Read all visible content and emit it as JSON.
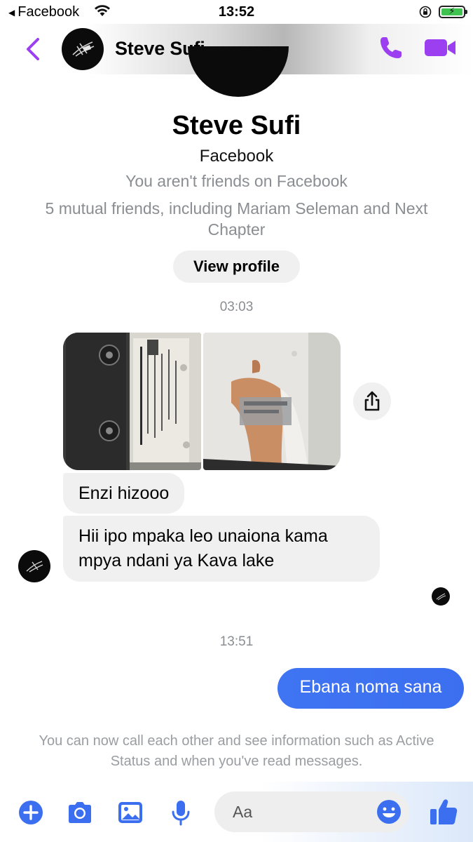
{
  "status_bar": {
    "back_app": "Facebook",
    "time": "13:52"
  },
  "header": {
    "contact_name": "Steve Sufi"
  },
  "profile": {
    "name": "Steve Sufi",
    "platform": "Facebook",
    "friend_status": "You aren't friends on Facebook",
    "mutual": "5 mutual friends, including Mariam Seleman and Next Chapter",
    "view_profile_label": "View profile"
  },
  "messages": {
    "timestamp_1": "03:03",
    "incoming_1": "Enzi hizooo",
    "incoming_2": "Hii ipo mpaka leo unaiona kama mpya ndani ya Kava lake",
    "timestamp_2": "13:51",
    "outgoing_1": "Ebana noma sana"
  },
  "info": {
    "text": "You can now call each other and see information such as Active Status and when you've read messages."
  },
  "composer": {
    "placeholder": "Aa"
  },
  "colors": {
    "accent_purple": "#9b3ff1",
    "accent_blue": "#3b6ff0",
    "secondary_text": "#8a8d91"
  },
  "icons": [
    "back-chevron-icon",
    "phone-icon",
    "video-camera-icon",
    "share-icon",
    "plus-icon",
    "camera-icon",
    "gallery-icon",
    "microphone-icon",
    "emoji-icon",
    "thumbs-up-icon"
  ]
}
